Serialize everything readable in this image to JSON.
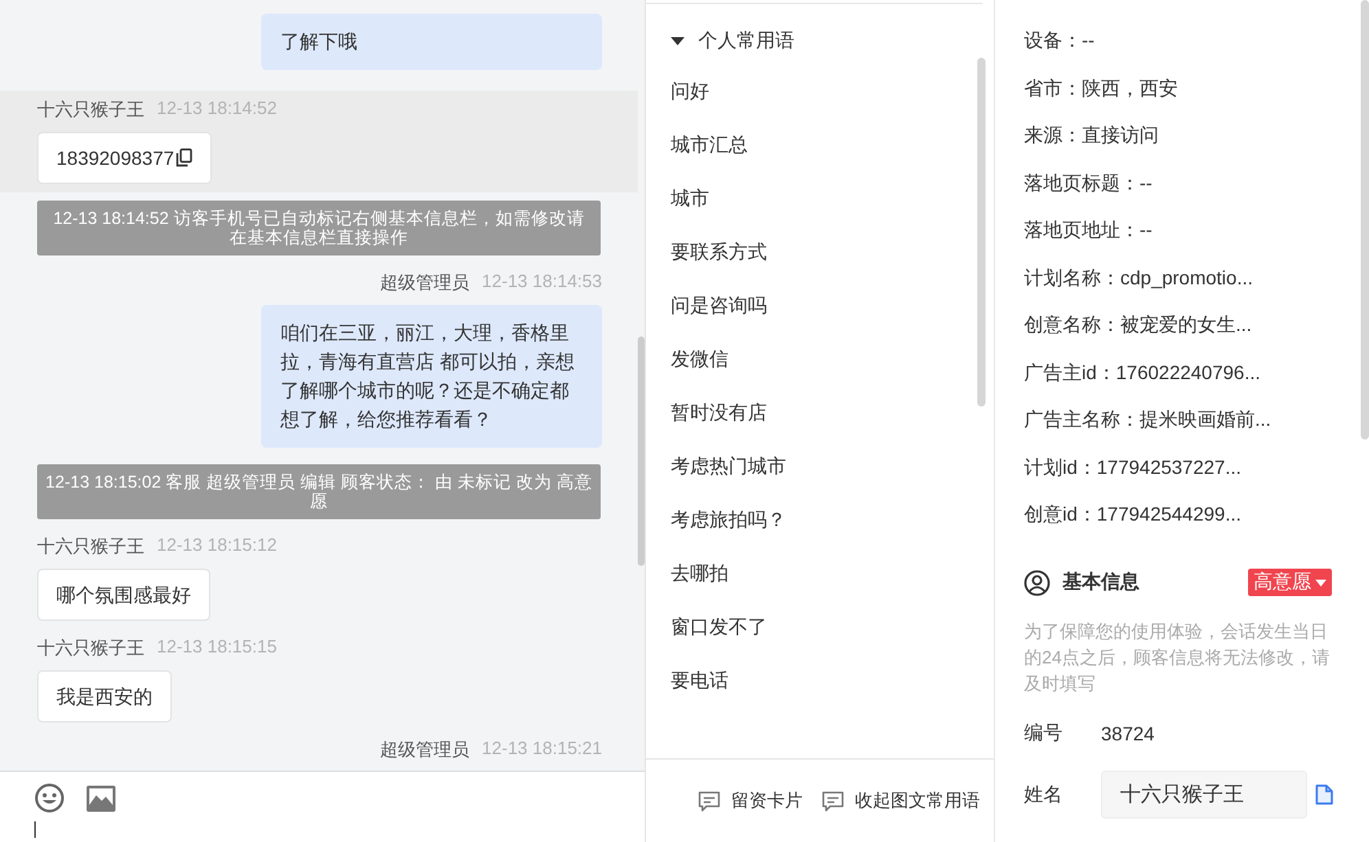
{
  "chat": {
    "messages": [
      {
        "kind": "agent",
        "text": "了解下哦"
      },
      {
        "kind": "visitor",
        "sender": "十六只猴子王",
        "time": "12-13 18:14:52",
        "text": "18392098377",
        "highlighted": true,
        "copyable": true
      },
      {
        "kind": "system",
        "text": "12-13 18:14:52 访客手机号已自动标记右侧基本信息栏，如需修改请在基本信息栏直接操作"
      },
      {
        "kind": "agent",
        "sender": "超级管理员",
        "time": "12-13 18:14:53",
        "text": "咱们在三亚，丽江，大理，香格里拉，青海有直营店 都可以拍，亲想了解哪个城市的呢？还是不确定都想了解，给您推荐看看？"
      },
      {
        "kind": "system",
        "text": "12-13 18:15:02 客服 超级管理员 编辑 顾客状态： 由 未标记 改为 高意愿"
      },
      {
        "kind": "visitor",
        "sender": "十六只猴子王",
        "time": "12-13 18:15:12",
        "text": "哪个氛围感最好"
      },
      {
        "kind": "visitor",
        "sender": "十六只猴子王",
        "time": "12-13 18:15:15",
        "text": "我是西安的"
      },
      {
        "kind": "agent",
        "sender": "超级管理员",
        "time": "12-13 18:15:21"
      }
    ]
  },
  "phrases": {
    "group": {
      "label": "个人常用语",
      "expanded": true
    },
    "items": [
      "问好",
      "城市汇总",
      "城市",
      "要联系方式",
      "问是咨询吗",
      "发微信",
      "暂时没有店",
      "考虑热门城市",
      "考虑旅拍吗？",
      "去哪拍",
      "窗口发不了",
      "要电话"
    ],
    "actions": [
      "留资卡片",
      "收起图文常用语"
    ]
  },
  "info": {
    "rows": [
      "设备：--",
      "省市：陕西，西安",
      "来源：直接访问",
      "落地页标题：--",
      "落地页地址：--",
      "计划名称：cdp_promotio...",
      "创意名称：被宠爱的女生...",
      "广告主id：176022240796...",
      "广告主名称：提米映画婚前...",
      "计划id：177942537227...",
      "创意id：177942544299..."
    ],
    "basic": {
      "title": "基本信息",
      "status": "高意愿",
      "note": "为了保障您的使用体验，会话发生当日的24点之后，顾客信息将无法修改，请及时填写",
      "fields": [
        {
          "kind": "static",
          "label": "编号",
          "value": "38724"
        },
        {
          "kind": "input",
          "label": "姓名",
          "value": "十六只猴子王"
        }
      ]
    }
  }
}
